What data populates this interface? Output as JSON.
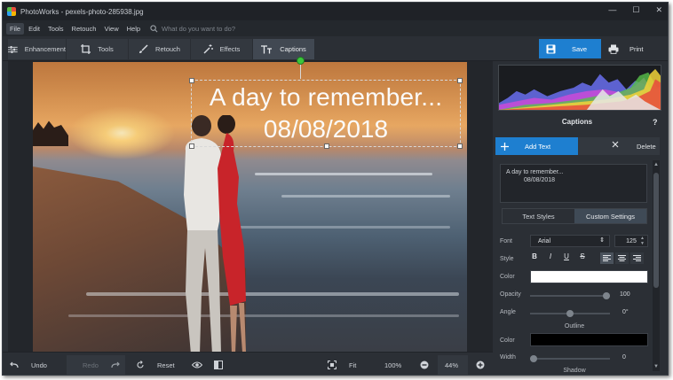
{
  "window": {
    "title": "PhotoWorks - pexels-photo-285938.jpg",
    "controls": [
      "—",
      "☐",
      "✕"
    ]
  },
  "menu": {
    "items": [
      "File",
      "Edit",
      "Tools",
      "Retouch",
      "View",
      "Help"
    ],
    "search_placeholder": "What do you want to do?"
  },
  "toolbar": {
    "tabs": [
      "Enhancement",
      "Tools",
      "Retouch",
      "Effects",
      "Captions"
    ],
    "active_tab": "Captions",
    "save_label": "Save",
    "print_label": "Print"
  },
  "canvas": {
    "caption_line1": "A day to remember...",
    "caption_line2": "08/08/2018"
  },
  "bottom": {
    "undo_label": "Undo",
    "redo_label": "Redo",
    "reset_label": "Reset",
    "fit_label": "Fit",
    "zoom_100_label": "100%",
    "zoom_value": "44%"
  },
  "panel": {
    "title": "Captions",
    "help": "?",
    "add_text_label": "Add Text",
    "delete_label": "Delete",
    "text_line1": "A day to remember...",
    "text_line2": "08/08/2018",
    "tab_text_styles": "Text Styles",
    "tab_custom_settings": "Custom Settings",
    "font_label": "Font",
    "font_value": "Arial",
    "font_size": "125",
    "style_label": "Style",
    "style_buttons": [
      "B",
      "I",
      "U",
      "S"
    ],
    "color_label": "Color",
    "text_color": "#ffffff",
    "opacity_label": "Opacity",
    "opacity_value": "100",
    "opacity_fraction": 1.0,
    "angle_label": "Angle",
    "angle_value": "0°",
    "angle_fraction": 0.5,
    "outline_label": "Outline",
    "outline_color_label": "Color",
    "outline_color": "#000000",
    "width_label": "Width",
    "width_value": "0",
    "width_fraction": 0.0,
    "shadow_label": "Shadow"
  },
  "colors": {
    "accent": "#1e7fd0",
    "window_bg": "#2b2f35",
    "rotation_handle": "#3cc73c"
  }
}
